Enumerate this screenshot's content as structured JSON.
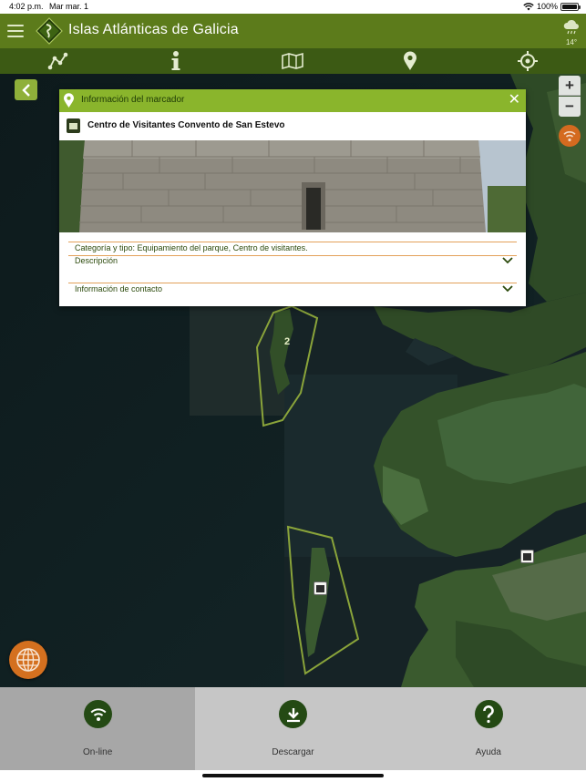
{
  "status_bar": {
    "time": "4:02 p.m.",
    "date": "Mar mar. 1",
    "battery": "100%"
  },
  "header": {
    "title": "Islas Atlánticas de Galicia",
    "weather_temp": "14°"
  },
  "toolbar": {
    "items": [
      "routes-icon",
      "info-icon",
      "map-layers-icon",
      "location-pin-icon",
      "crosshair-icon"
    ]
  },
  "map": {
    "area_labels": [
      "2"
    ]
  },
  "popup": {
    "header_title": "Información del marcador",
    "close_label": "✕",
    "poi_name": "Centro de Visitantes Convento de San Estevo",
    "category_line": "Categoría y tipo: Equipamiento del parque, Centro de visitantes.",
    "description_label": "Descripción",
    "contact_label": "Información de contacto"
  },
  "bottom_tabs": [
    {
      "label": "On-line",
      "icon": "wifi-icon",
      "active": true
    },
    {
      "label": "Descargar",
      "icon": "download-icon",
      "active": false
    },
    {
      "label": "Ayuda",
      "icon": "help-icon",
      "active": false
    }
  ],
  "colors": {
    "header": "#5c7b1b",
    "toolbar": "#3c5a14",
    "popup_header": "#8ab52c",
    "accent_orange": "#d46a1f",
    "divider": "#e3a15a"
  }
}
